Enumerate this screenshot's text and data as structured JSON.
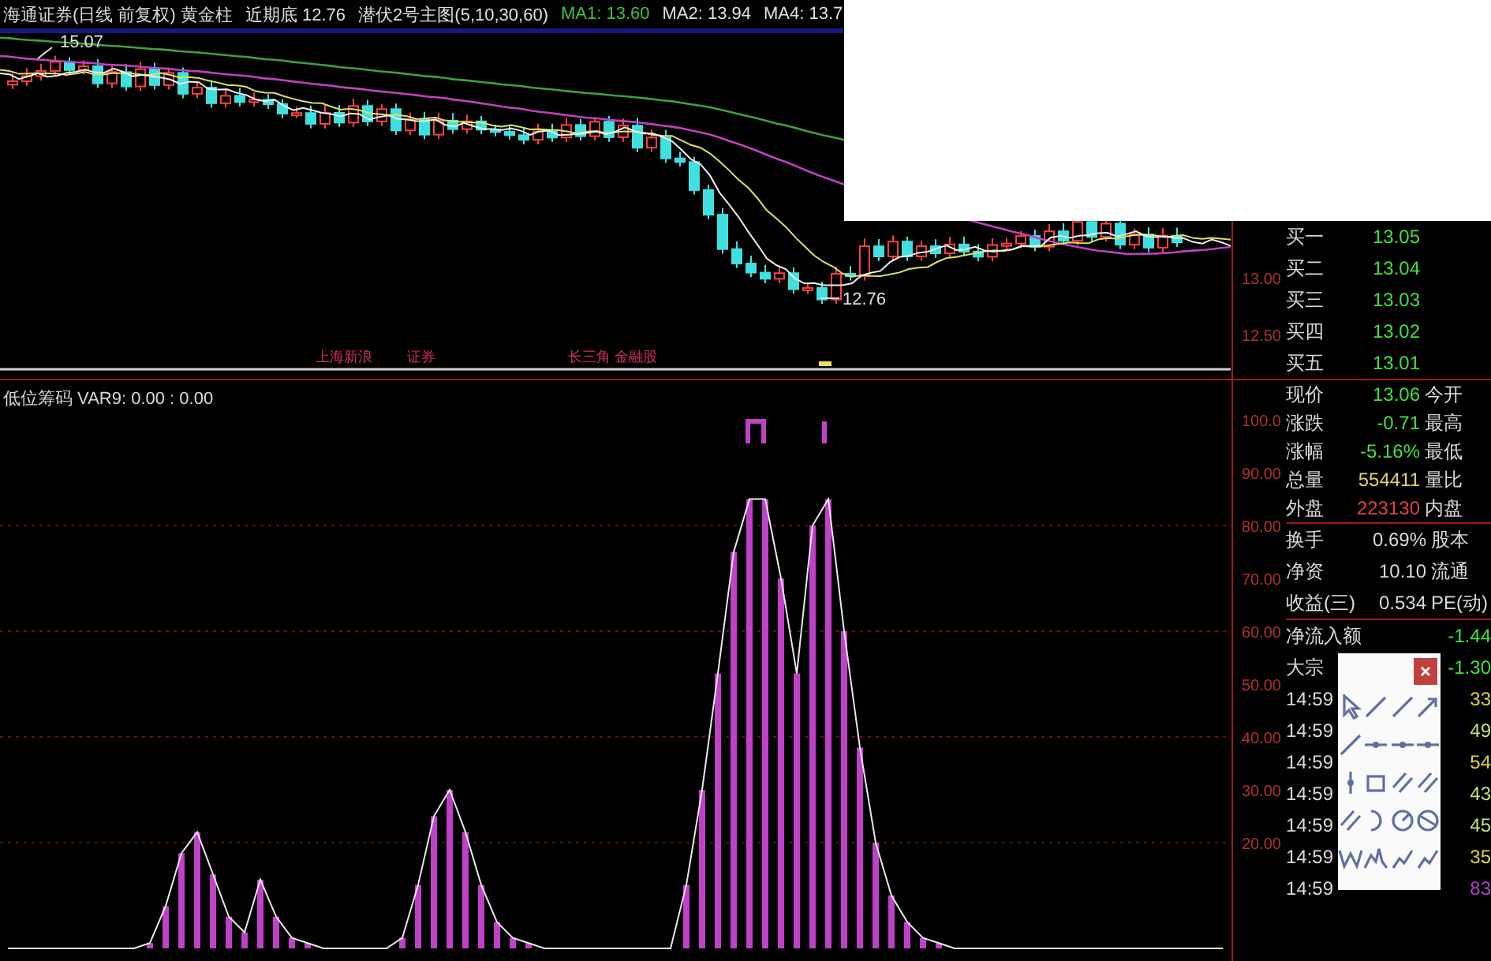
{
  "header": {
    "title": "海通证券(日线 前复权) 黄金柱",
    "items": [
      {
        "text": "近期底 12.76",
        "color": "#e0e0e0"
      },
      {
        "text": "潜伏2号主图(5,10,30,60)",
        "color": "#e0e0e0"
      },
      {
        "text": "MA1: 13.60",
        "color": "#40c040"
      },
      {
        "text": "MA2: 13.94",
        "color": "#e0e0e0"
      },
      {
        "text": "MA4: 13.7",
        "color": "#e0e0e0"
      }
    ]
  },
  "price_chart": {
    "high_label": "15.07",
    "low_label": "12.76",
    "axis_labels": [
      "13.00",
      "12.50"
    ],
    "annotations": [
      "上海新浪",
      "证券",
      "长三角 金融股"
    ]
  },
  "indicator": {
    "title": "低位筹码 VAR9: 0.00 : 0.00",
    "chart_data": {
      "type": "bar",
      "ylim": [
        0,
        100
      ],
      "grid": true,
      "yticks": [
        {
          "value": 100,
          "label": "100.0"
        },
        {
          "value": 90,
          "label": "90.00"
        },
        {
          "value": 80,
          "label": "80.00"
        },
        {
          "value": 70,
          "label": "70.00"
        },
        {
          "value": 60,
          "label": "60.00"
        },
        {
          "value": 50,
          "label": "50.00"
        },
        {
          "value": 40,
          "label": "40.00"
        },
        {
          "value": 30,
          "label": "30.00"
        },
        {
          "value": 20,
          "label": "20.00"
        }
      ],
      "series": [
        {
          "color": "#c040c8",
          "values": [
            0,
            0,
            0,
            0,
            0,
            0,
            0,
            0,
            0,
            1,
            8,
            18,
            22,
            14,
            6,
            3,
            13,
            6,
            2,
            1,
            0,
            0,
            0,
            0,
            0,
            2,
            12,
            25,
            30,
            22,
            12,
            5,
            2,
            1,
            0,
            0,
            0,
            0,
            0,
            0,
            0,
            0,
            0,
            12,
            30,
            52,
            75,
            85,
            85,
            70,
            52,
            80,
            85,
            60,
            38,
            20,
            10,
            5,
            2,
            1,
            0,
            0,
            0,
            0,
            0,
            0,
            0,
            0,
            0,
            0,
            0,
            0,
            0,
            0,
            0,
            0,
            0,
            0
          ]
        }
      ]
    }
  },
  "quote_panel": {
    "bids": [
      {
        "label": "买一",
        "price": "13.05"
      },
      {
        "label": "买二",
        "price": "13.04"
      },
      {
        "label": "买三",
        "price": "13.03"
      },
      {
        "label": "买四",
        "price": "13.02"
      },
      {
        "label": "买五",
        "price": "13.01"
      }
    ],
    "stats": [
      {
        "label": "现价",
        "value": "13.06",
        "suffix": "今开",
        "color": "#40e040"
      },
      {
        "label": "涨跌",
        "value": "-0.71",
        "suffix": "最高",
        "color": "#40e040"
      },
      {
        "label": "涨幅",
        "value": "-5.16%",
        "suffix": "最低",
        "color": "#40e040"
      },
      {
        "label": "总量",
        "value": "554411",
        "suffix": "量比",
        "color": "#e0d070"
      },
      {
        "label": "外盘",
        "value": "223130",
        "suffix": "内盘",
        "color": "#e04050"
      }
    ],
    "stats2": [
      {
        "label": "换手",
        "value": "0.69%",
        "suffix": "股本"
      },
      {
        "label": "净资",
        "value": "10.10",
        "suffix": "流通"
      },
      {
        "label": "收益(三)",
        "value": "0.534",
        "suffix": "PE(动)"
      }
    ],
    "flows": [
      {
        "label": "净流入额",
        "value": "-1.44"
      },
      {
        "label": "大宗",
        "value": "-1.30"
      }
    ],
    "ticks": [
      {
        "time": "14:59",
        "volume": "33",
        "color": "#e0d040"
      },
      {
        "time": "14:59",
        "volume": "49",
        "color": "#c8e070"
      },
      {
        "time": "14:59",
        "volume": "54",
        "color": "#e0d040"
      },
      {
        "time": "14:59",
        "volume": "43",
        "color": "#c8e070"
      },
      {
        "time": "14:59",
        "volume": "45",
        "color": "#c8e070"
      },
      {
        "time": "14:59",
        "volume": "35",
        "color": "#e0d040"
      },
      {
        "time": "14:59",
        "volume": "83",
        "color": "#b040d0"
      }
    ]
  },
  "toolbox": {
    "tools": [
      {
        "kind": "pointer"
      },
      {
        "kind": "line"
      },
      {
        "kind": "line"
      },
      {
        "kind": "arrow"
      },
      {
        "kind": "line"
      },
      {
        "kind": "segment"
      },
      {
        "kind": "segment"
      },
      {
        "kind": "segment"
      },
      {
        "kind": "vertical"
      },
      {
        "kind": "box"
      },
      {
        "kind": "parallel"
      },
      {
        "kind": "parallel"
      },
      {
        "kind": "parallel"
      },
      {
        "kind": "arc"
      },
      {
        "kind": "circle"
      },
      {
        "kind": "circle-slash"
      },
      {
        "kind": "wave"
      },
      {
        "kind": "peaks"
      },
      {
        "kind": "zigzag"
      },
      {
        "kind": "zigzag"
      }
    ]
  }
}
